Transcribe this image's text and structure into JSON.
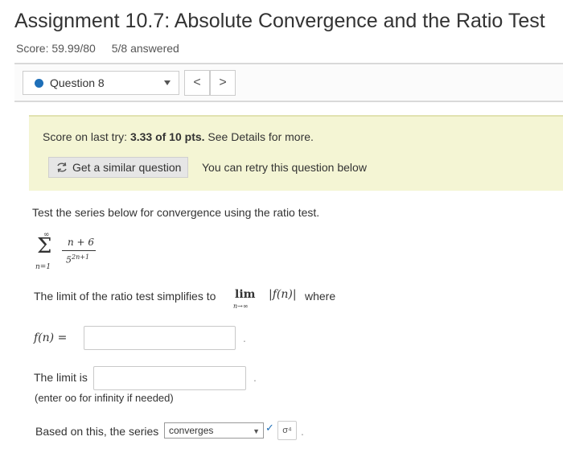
{
  "assignment": {
    "title": "Assignment 10.7: Absolute Convergence and the Ratio Test",
    "score": "Score: 59.99/80",
    "answered": "5/8 answered"
  },
  "question_nav": {
    "selected": "Question 8",
    "prev": "<",
    "next": ">"
  },
  "score_box": {
    "prefix": "Score on last try: ",
    "score": "3.33 of 10 pts.",
    "suffix": " See Details for more.",
    "similar_button": "Get a similar question",
    "retry_text": "You can retry this question below"
  },
  "question": {
    "prompt": "Test the series below for convergence using the ratio test.",
    "series": {
      "upper": "∞",
      "lower": "n=1",
      "numerator": "n + 6",
      "denominator_base": "5",
      "denominator_exp": "2n+1"
    },
    "limit_text": "The limit of the ratio test simplifies to",
    "lim_word": "lim",
    "lim_sub": "n→∞",
    "abs_f": "|f(n)|",
    "where": "where",
    "f_label": "f(n) =",
    "f_value": "",
    "limit_is_label": "The limit is",
    "limit_value": "",
    "oo_note": "(enter oo for infinity if needed)",
    "based_label": "Based on this, the series",
    "series_result": "converges",
    "check_mark": "✓",
    "sigma_button": "σ⁴"
  }
}
